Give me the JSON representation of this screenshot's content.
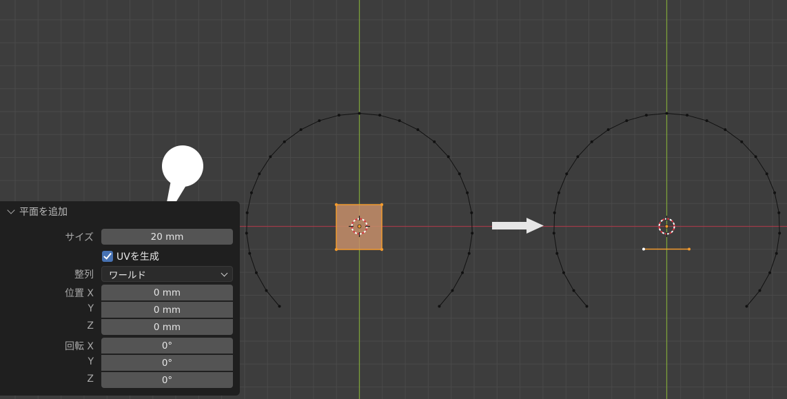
{
  "panel": {
    "title": "平面を追加",
    "size_label": "サイズ",
    "size_value": "20 mm",
    "uv_label": "UVを生成",
    "uv_checked": true,
    "align_label": "整列",
    "align_value": "ワールド",
    "location_label": "位置",
    "location": [
      {
        "axis": "X",
        "value": "0 mm"
      },
      {
        "axis": "Y",
        "value": "0 mm"
      },
      {
        "axis": "Z",
        "value": "0 mm"
      }
    ],
    "rotation_label": "回転",
    "rotation": [
      {
        "axis": "X",
        "value": "0°"
      },
      {
        "axis": "Y",
        "value": "0°"
      },
      {
        "axis": "Z",
        "value": "0°"
      }
    ]
  },
  "colors": {
    "background": "#3d3d3d",
    "grid": "#4a4a4a",
    "x_axis": "#a13a48",
    "y_axis": "#7da13a",
    "selection": "#f39b2e",
    "checkbox": "#4772b3"
  },
  "icons": [
    "chevron-down-icon",
    "checkmark-icon",
    "dropdown-caret-icon",
    "arrow-right-icon",
    "3d-cursor-icon",
    "origin-icon",
    "callout-bubble-icon"
  ]
}
